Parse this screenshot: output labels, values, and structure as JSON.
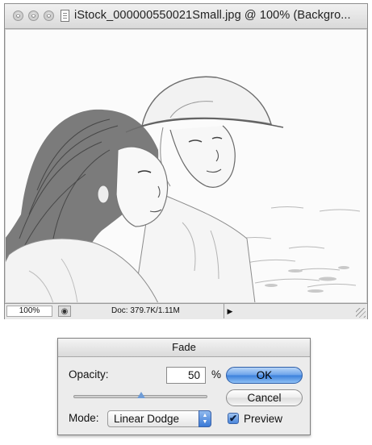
{
  "window": {
    "title": "iStock_000000550021Small.jpg @ 100% (Backgro...",
    "zoom": "100%",
    "doc_info": "Doc: 379.7K/1.11M",
    "traffic_lights": [
      "close-icon",
      "minimize-icon",
      "zoom-icon"
    ]
  },
  "dialog": {
    "title": "Fade",
    "opacity_label": "Opacity:",
    "opacity_value": "50",
    "opacity_unit": "%",
    "opacity_slider_fraction": 0.5,
    "mode_label": "Mode:",
    "mode_value": "Linear Dodge",
    "ok_label": "OK",
    "cancel_label": "Cancel",
    "preview_label": "Preview",
    "preview_checked": true,
    "colors": {
      "accent": "#3a7fdb"
    }
  }
}
